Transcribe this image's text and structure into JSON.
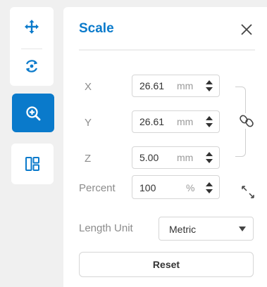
{
  "toolbar": {
    "tools": [
      {
        "icon": "move-icon",
        "active": false
      },
      {
        "icon": "rotate-icon",
        "active": false
      },
      {
        "icon": "scale-zoom-icon",
        "active": true
      },
      {
        "icon": "layout-icon",
        "active": false
      }
    ]
  },
  "panel": {
    "title": "Scale",
    "close_icon": "close-icon",
    "x": {
      "label": "X",
      "value": "26.61",
      "unit": "mm"
    },
    "y": {
      "label": "Y",
      "value": "26.61",
      "unit": "mm"
    },
    "z": {
      "label": "Z",
      "value": "5.00",
      "unit": "mm"
    },
    "percent": {
      "label": "Percent",
      "value": "100",
      "unit": "%"
    },
    "length_unit": {
      "label": "Length Unit",
      "value": "Metric"
    },
    "reset_label": "Reset",
    "link_icon": "link-icon",
    "expand_icon": "expand-icon"
  },
  "colors": {
    "accent": "#0a7acb",
    "panel_bg": "#ffffff",
    "app_bg": "#f0f0f0"
  }
}
